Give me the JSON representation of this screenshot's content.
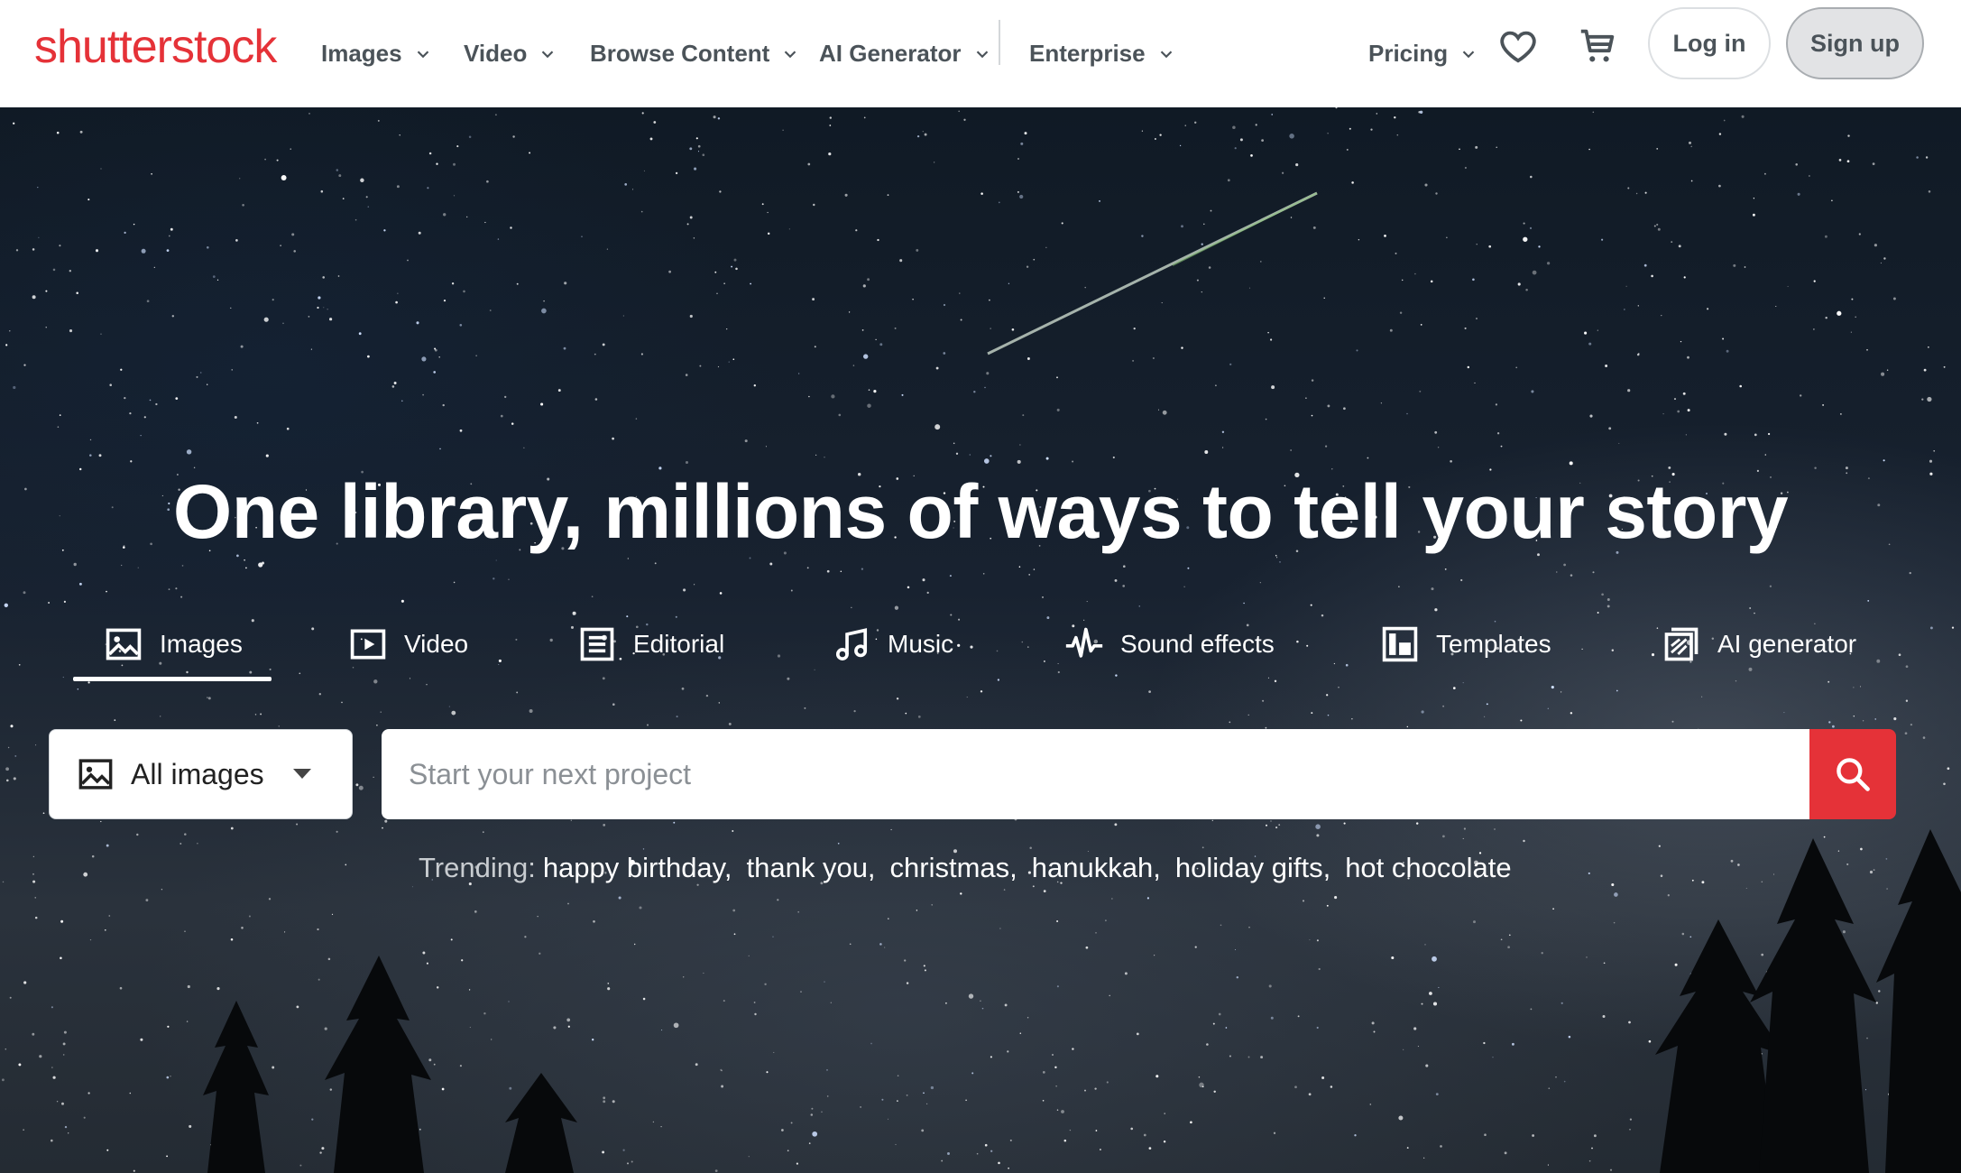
{
  "brand": {
    "logo_text": "shutterstock",
    "color": "#e53238"
  },
  "nav": {
    "items": [
      {
        "label": "Images"
      },
      {
        "label": "Video"
      },
      {
        "label": "Browse Content"
      },
      {
        "label": "AI Generator"
      },
      {
        "label": "Enterprise"
      }
    ],
    "pricing": "Pricing",
    "login": "Log in",
    "signup": "Sign up",
    "icons": [
      "heart-icon",
      "cart-icon"
    ]
  },
  "hero": {
    "headline": "One library, millions of ways to tell your story",
    "tabs": [
      {
        "label": "Images",
        "icon": "image-icon",
        "active": true
      },
      {
        "label": "Video",
        "icon": "video-icon"
      },
      {
        "label": "Editorial",
        "icon": "editorial-icon"
      },
      {
        "label": "Music",
        "icon": "music-note-icon"
      },
      {
        "label": "Sound effects",
        "icon": "waveform-icon"
      },
      {
        "label": "Templates",
        "icon": "templates-icon"
      },
      {
        "label": "AI generator",
        "icon": "ai-generator-icon"
      }
    ]
  },
  "search": {
    "type_selected": "All images",
    "placeholder": "Start your next project",
    "button_color": "#e53238"
  },
  "trending": {
    "label": "Trending:",
    "terms": [
      "happy birthday,",
      "thank you,",
      "christmas,",
      "hanukkah,",
      "holiday gifts,",
      "hot chocolate"
    ]
  }
}
